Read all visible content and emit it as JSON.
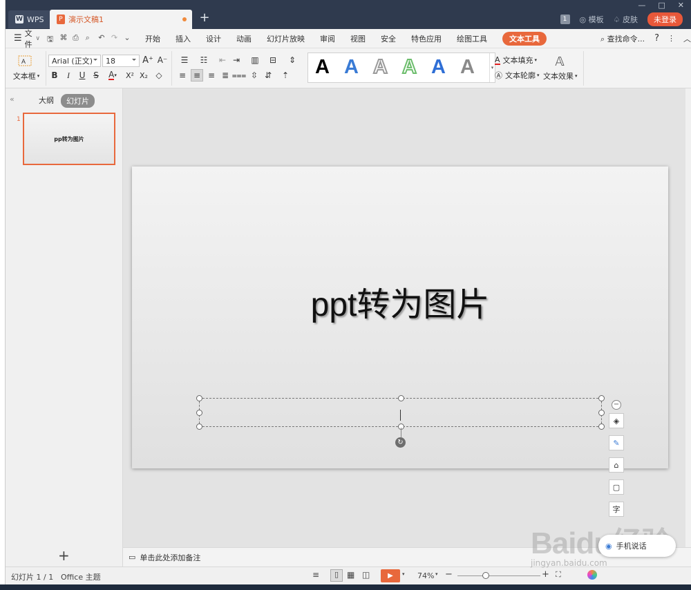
{
  "window": {
    "wps_tab": "WPS",
    "doc_tab": "演示文稿1",
    "add_tab": "+",
    "badge": "1",
    "template": "模板",
    "skin": "皮肤",
    "login": "未登录"
  },
  "menu": {
    "file": "文件",
    "items": [
      "开始",
      "插入",
      "设计",
      "动画",
      "幻灯片放映",
      "审阅",
      "视图",
      "安全",
      "特色应用",
      "绘图工具"
    ],
    "active": "文本工具",
    "search": "查找命令...",
    "help": "?"
  },
  "ribbon": {
    "textbox": "文本框",
    "font": "Arial (正文)",
    "size": "18",
    "text_fill": "文本填充",
    "text_outline": "文本轮廓",
    "text_effect": "文本效果",
    "style_letter": "A"
  },
  "panel": {
    "outline_tab": "大纲",
    "slides_tab": "幻灯片",
    "slide_number": "1",
    "thumb_title": "pp转为图片",
    "add_slide": "+"
  },
  "slide": {
    "title": "ppt转为图片"
  },
  "notes": {
    "placeholder": "单击此处添加备注"
  },
  "status": {
    "slide_info": "幻灯片 1 / 1",
    "theme": "Office 主题",
    "zoom": "74%"
  },
  "overlay": {
    "voice": "手机说话",
    "watermark": "Baidu经验",
    "watermark_url": "jingyan.baidu.com"
  },
  "colors": {
    "accent": "#e8683c",
    "titlebar": "#2f3a4e",
    "style_blue": "#3a7bd5"
  }
}
